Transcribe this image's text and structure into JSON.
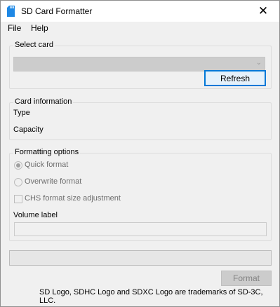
{
  "window": {
    "title": "SD Card Formatter",
    "close_glyph": "✕",
    "icon": "sd-card-icon",
    "icon_color": "#1e88e5"
  },
  "menu": {
    "file": "File",
    "help": "Help"
  },
  "select_card": {
    "legend": "Select card",
    "selected_value": "",
    "refresh_label": "Refresh"
  },
  "card_info": {
    "legend": "Card information",
    "type_label": "Type",
    "capacity_label": "Capacity"
  },
  "formatting": {
    "legend": "Formatting options",
    "quick_format": "Quick format",
    "overwrite_format": "Overwrite format",
    "chs_adjustment": "CHS format size adjustment",
    "volume_label": "Volume label",
    "volume_value": "",
    "selected_option": "Quick format"
  },
  "progress": {
    "value": 0
  },
  "actions": {
    "format_label": "Format"
  },
  "footer": {
    "trademark": "SD Logo, SDHC Logo and SDXC Logo are trademarks of SD-3C, LLC."
  },
  "colors": {
    "accent": "#0078d7"
  }
}
